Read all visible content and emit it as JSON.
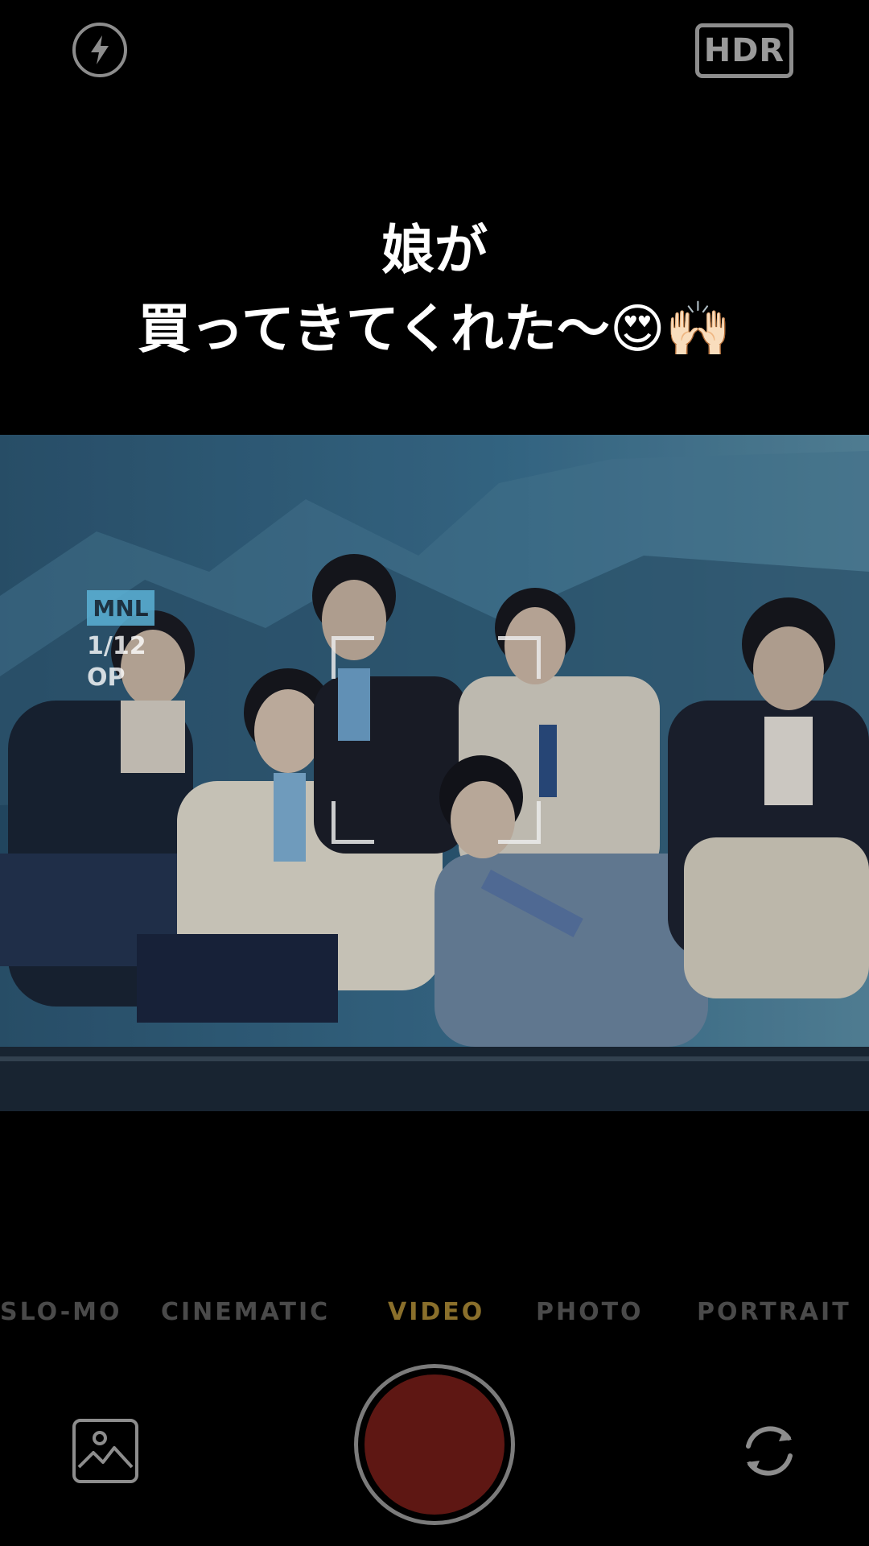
{
  "top_bar": {
    "hdr_label": "HDR",
    "flash_icon": "flash-icon"
  },
  "caption": {
    "line1": "娘が",
    "line2": "買ってきてくれた〜😍🙌🏻"
  },
  "viewfinder_overlay": {
    "badge": "MNL",
    "page_count": "1/12",
    "op_text": "OP"
  },
  "modes": {
    "items": [
      {
        "label": "SLO-MO"
      },
      {
        "label": "CINEMATIC"
      },
      {
        "label": "VIDEO"
      },
      {
        "label": "PHOTO"
      },
      {
        "label": "PORTRAIT"
      }
    ],
    "active": "VIDEO"
  },
  "controls": {
    "gallery_icon": "gallery-icon",
    "shutter": "record-button",
    "flip_icon": "camera-flip-icon"
  },
  "colors": {
    "active_mode": "#8a6f2b",
    "inactive_mode": "#4a4a4a",
    "shutter": "#5e1713"
  }
}
